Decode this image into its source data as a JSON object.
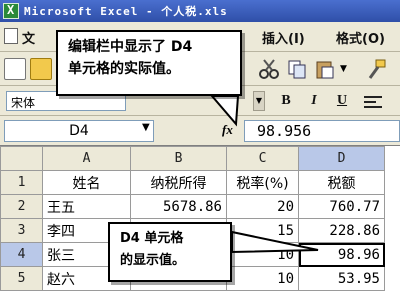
{
  "window": {
    "title": "Microsoft Excel - 个人税.xls",
    "app_icon": "excel-icon"
  },
  "menu": {
    "file_partial": "文",
    "insert": "插入(I)",
    "format": "格式(O)"
  },
  "toolbar": {
    "font_name": "宋体"
  },
  "formula_bar": {
    "name_box": "D4",
    "fx": "fx",
    "value": "98.956"
  },
  "grid": {
    "columns": [
      "A",
      "B",
      "C",
      "D"
    ],
    "rows": [
      {
        "num": "1",
        "cells": [
          "姓名",
          "纳税所得",
          "税率(%)",
          "税额"
        ]
      },
      {
        "num": "2",
        "cells": [
          "王五",
          "5678.86",
          "20",
          "760.77"
        ]
      },
      {
        "num": "3",
        "cells": [
          "李四",
          "",
          "15",
          "228.86"
        ]
      },
      {
        "num": "4",
        "cells": [
          "张三",
          "",
          "10",
          "98.96"
        ]
      },
      {
        "num": "5",
        "cells": [
          "赵六",
          "",
          "10",
          "53.95"
        ]
      }
    ],
    "active_cell": "D4"
  },
  "callouts": {
    "top": {
      "line1": "编辑栏中显示了 D4",
      "line2": "单元格的实际值。"
    },
    "bottom": {
      "line1": "D4 单元格",
      "line2": "的显示值。"
    }
  }
}
